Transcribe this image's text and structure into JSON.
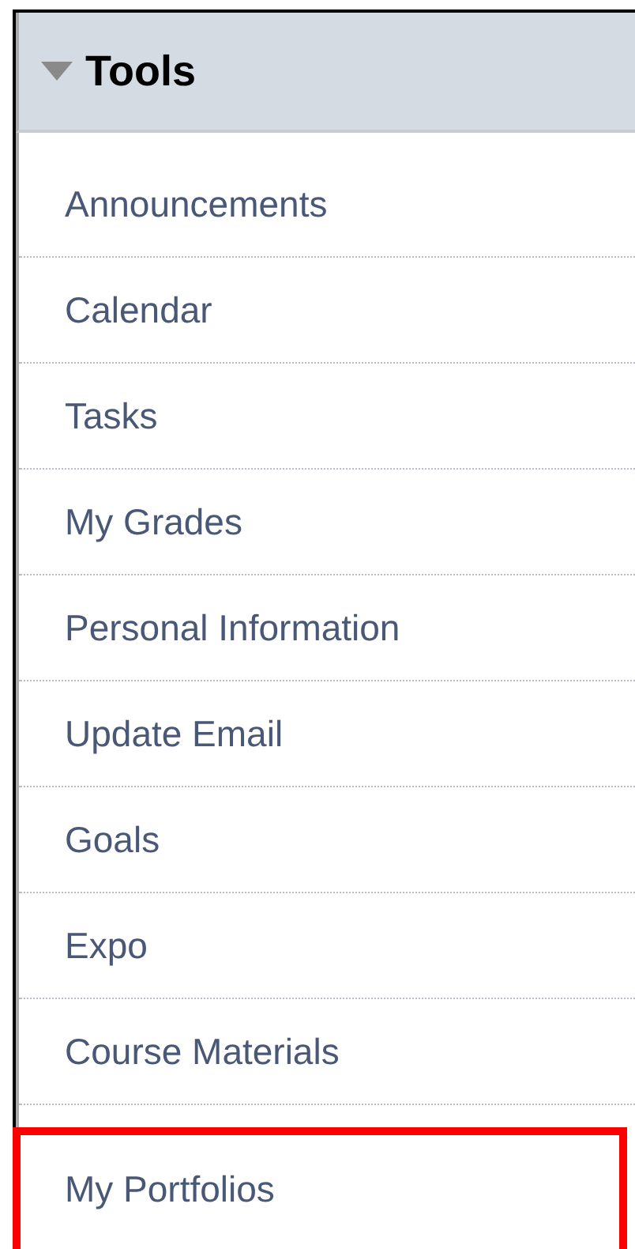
{
  "panel": {
    "title": "Tools",
    "expanded": true,
    "items": [
      {
        "label": "Announcements",
        "highlighted": false
      },
      {
        "label": "Calendar",
        "highlighted": false
      },
      {
        "label": "Tasks",
        "highlighted": false
      },
      {
        "label": "My Grades",
        "highlighted": false
      },
      {
        "label": "Personal Information",
        "highlighted": false
      },
      {
        "label": "Update Email",
        "highlighted": false
      },
      {
        "label": "Goals",
        "highlighted": false
      },
      {
        "label": "Expo",
        "highlighted": false
      },
      {
        "label": "Course Materials",
        "highlighted": false
      },
      {
        "label": "My Portfolios",
        "highlighted": true
      }
    ]
  }
}
